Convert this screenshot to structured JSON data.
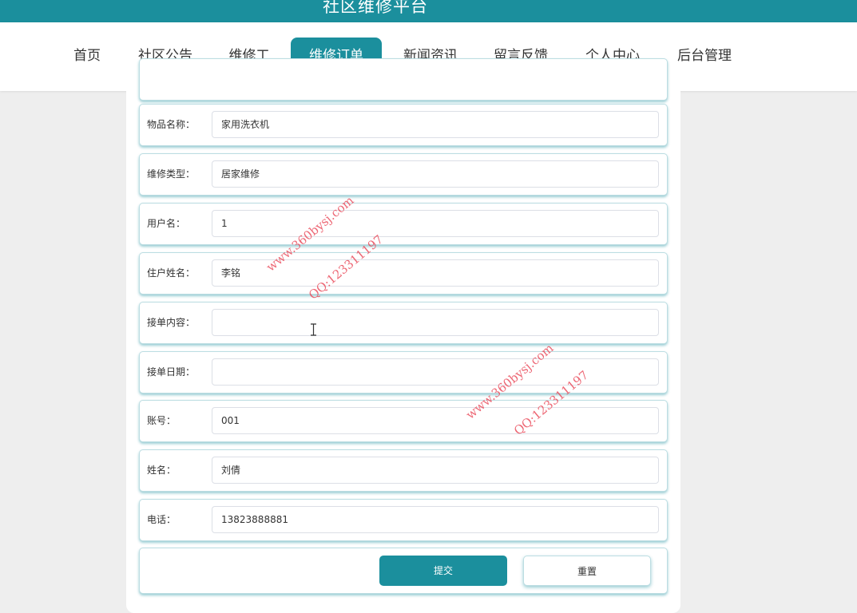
{
  "header": {
    "title": "社区维修平台"
  },
  "nav": {
    "items": [
      {
        "label": "首页"
      },
      {
        "label": "社区公告"
      },
      {
        "label": "维修工"
      },
      {
        "label": "维修订单",
        "active": true
      },
      {
        "label": "新闻资讯"
      },
      {
        "label": "留言反馈"
      },
      {
        "label": "个人中心"
      },
      {
        "label": "后台管理"
      }
    ]
  },
  "form": {
    "fields": [
      {
        "label": "物品名称：",
        "value": "家用洗衣机"
      },
      {
        "label": "维修类型：",
        "value": "居家维修"
      },
      {
        "label": "用户名：",
        "value": "1"
      },
      {
        "label": "住户姓名：",
        "value": "李铭"
      },
      {
        "label": "接单内容：",
        "value": ""
      },
      {
        "label": "接单日期：",
        "value": ""
      },
      {
        "label": "账号：",
        "value": "001"
      },
      {
        "label": "姓名：",
        "value": "刘倩"
      },
      {
        "label": "电话：",
        "value": "13823888881"
      }
    ],
    "submit_label": "提交",
    "reset_label": "重置"
  },
  "watermarks": [
    {
      "site": "www.360bysj.com",
      "qq": "QQ:123311197"
    },
    {
      "site": "www.360bysj.com",
      "qq": "QQ:123311197"
    }
  ],
  "colors": {
    "accent": "#1b8f9d",
    "watermark": "#ea4e5e",
    "background": "#eeeeee"
  }
}
